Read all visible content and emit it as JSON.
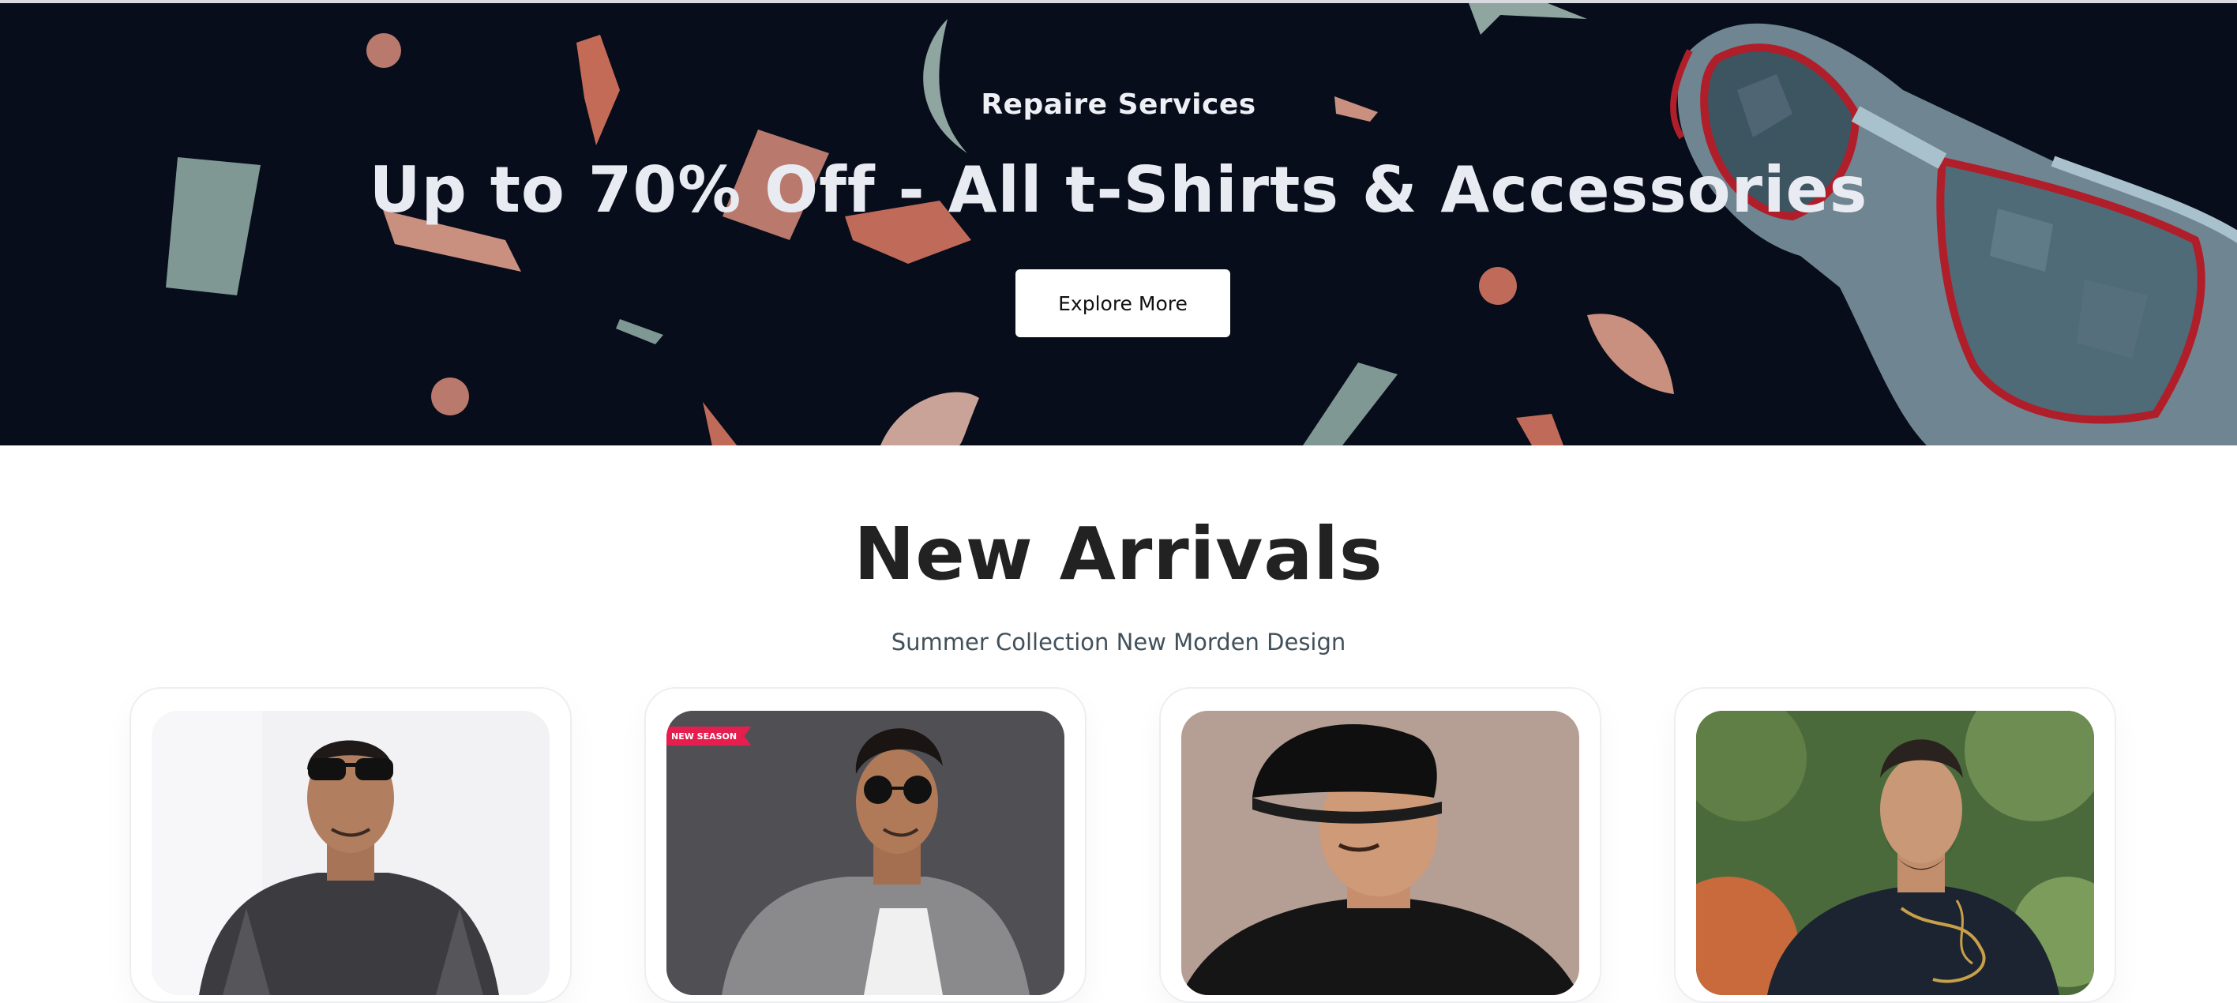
{
  "banner": {
    "kicker": "Repaire Services",
    "title": "Up to 70% Off - All t-Shirts & Accessories",
    "cta_label": "Explore More",
    "background_color": "#070d1a"
  },
  "section": {
    "title": "New Arrivals",
    "subtitle": "Summer Collection New Morden Design"
  },
  "products": [
    {
      "image": "man-dark-sunglasses-plaid-shirt-photo"
    },
    {
      "image": "man-round-sunglasses-grey-jacket-photo",
      "badge": "NEW SEASON"
    },
    {
      "image": "man-black-cap-black-tshirt-photo"
    },
    {
      "image": "bearded-man-black-printed-sweatshirt-photo"
    }
  ]
}
